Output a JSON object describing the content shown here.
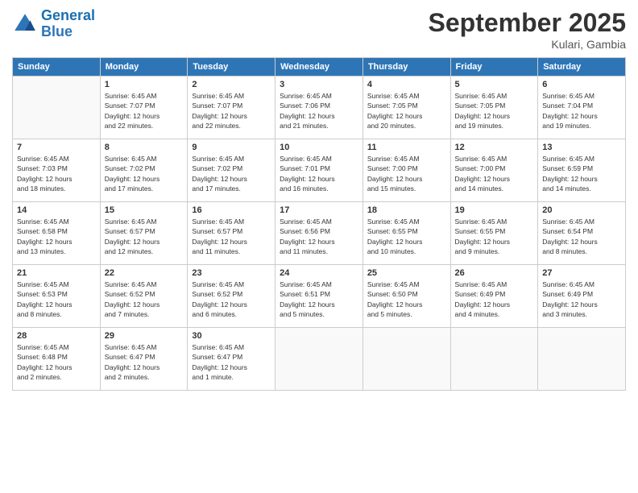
{
  "header": {
    "logo_line1": "General",
    "logo_line2": "Blue",
    "month": "September 2025",
    "location": "Kulari, Gambia"
  },
  "weekdays": [
    "Sunday",
    "Monday",
    "Tuesday",
    "Wednesday",
    "Thursday",
    "Friday",
    "Saturday"
  ],
  "weeks": [
    [
      {
        "day": "",
        "info": ""
      },
      {
        "day": "1",
        "info": "Sunrise: 6:45 AM\nSunset: 7:07 PM\nDaylight: 12 hours\nand 22 minutes."
      },
      {
        "day": "2",
        "info": "Sunrise: 6:45 AM\nSunset: 7:07 PM\nDaylight: 12 hours\nand 22 minutes."
      },
      {
        "day": "3",
        "info": "Sunrise: 6:45 AM\nSunset: 7:06 PM\nDaylight: 12 hours\nand 21 minutes."
      },
      {
        "day": "4",
        "info": "Sunrise: 6:45 AM\nSunset: 7:05 PM\nDaylight: 12 hours\nand 20 minutes."
      },
      {
        "day": "5",
        "info": "Sunrise: 6:45 AM\nSunset: 7:05 PM\nDaylight: 12 hours\nand 19 minutes."
      },
      {
        "day": "6",
        "info": "Sunrise: 6:45 AM\nSunset: 7:04 PM\nDaylight: 12 hours\nand 19 minutes."
      }
    ],
    [
      {
        "day": "7",
        "info": "Sunrise: 6:45 AM\nSunset: 7:03 PM\nDaylight: 12 hours\nand 18 minutes."
      },
      {
        "day": "8",
        "info": "Sunrise: 6:45 AM\nSunset: 7:02 PM\nDaylight: 12 hours\nand 17 minutes."
      },
      {
        "day": "9",
        "info": "Sunrise: 6:45 AM\nSunset: 7:02 PM\nDaylight: 12 hours\nand 17 minutes."
      },
      {
        "day": "10",
        "info": "Sunrise: 6:45 AM\nSunset: 7:01 PM\nDaylight: 12 hours\nand 16 minutes."
      },
      {
        "day": "11",
        "info": "Sunrise: 6:45 AM\nSunset: 7:00 PM\nDaylight: 12 hours\nand 15 minutes."
      },
      {
        "day": "12",
        "info": "Sunrise: 6:45 AM\nSunset: 7:00 PM\nDaylight: 12 hours\nand 14 minutes."
      },
      {
        "day": "13",
        "info": "Sunrise: 6:45 AM\nSunset: 6:59 PM\nDaylight: 12 hours\nand 14 minutes."
      }
    ],
    [
      {
        "day": "14",
        "info": "Sunrise: 6:45 AM\nSunset: 6:58 PM\nDaylight: 12 hours\nand 13 minutes."
      },
      {
        "day": "15",
        "info": "Sunrise: 6:45 AM\nSunset: 6:57 PM\nDaylight: 12 hours\nand 12 minutes."
      },
      {
        "day": "16",
        "info": "Sunrise: 6:45 AM\nSunset: 6:57 PM\nDaylight: 12 hours\nand 11 minutes."
      },
      {
        "day": "17",
        "info": "Sunrise: 6:45 AM\nSunset: 6:56 PM\nDaylight: 12 hours\nand 11 minutes."
      },
      {
        "day": "18",
        "info": "Sunrise: 6:45 AM\nSunset: 6:55 PM\nDaylight: 12 hours\nand 10 minutes."
      },
      {
        "day": "19",
        "info": "Sunrise: 6:45 AM\nSunset: 6:55 PM\nDaylight: 12 hours\nand 9 minutes."
      },
      {
        "day": "20",
        "info": "Sunrise: 6:45 AM\nSunset: 6:54 PM\nDaylight: 12 hours\nand 8 minutes."
      }
    ],
    [
      {
        "day": "21",
        "info": "Sunrise: 6:45 AM\nSunset: 6:53 PM\nDaylight: 12 hours\nand 8 minutes."
      },
      {
        "day": "22",
        "info": "Sunrise: 6:45 AM\nSunset: 6:52 PM\nDaylight: 12 hours\nand 7 minutes."
      },
      {
        "day": "23",
        "info": "Sunrise: 6:45 AM\nSunset: 6:52 PM\nDaylight: 12 hours\nand 6 minutes."
      },
      {
        "day": "24",
        "info": "Sunrise: 6:45 AM\nSunset: 6:51 PM\nDaylight: 12 hours\nand 5 minutes."
      },
      {
        "day": "25",
        "info": "Sunrise: 6:45 AM\nSunset: 6:50 PM\nDaylight: 12 hours\nand 5 minutes."
      },
      {
        "day": "26",
        "info": "Sunrise: 6:45 AM\nSunset: 6:49 PM\nDaylight: 12 hours\nand 4 minutes."
      },
      {
        "day": "27",
        "info": "Sunrise: 6:45 AM\nSunset: 6:49 PM\nDaylight: 12 hours\nand 3 minutes."
      }
    ],
    [
      {
        "day": "28",
        "info": "Sunrise: 6:45 AM\nSunset: 6:48 PM\nDaylight: 12 hours\nand 2 minutes."
      },
      {
        "day": "29",
        "info": "Sunrise: 6:45 AM\nSunset: 6:47 PM\nDaylight: 12 hours\nand 2 minutes."
      },
      {
        "day": "30",
        "info": "Sunrise: 6:45 AM\nSunset: 6:47 PM\nDaylight: 12 hours\nand 1 minute."
      },
      {
        "day": "",
        "info": ""
      },
      {
        "day": "",
        "info": ""
      },
      {
        "day": "",
        "info": ""
      },
      {
        "day": "",
        "info": ""
      }
    ]
  ]
}
